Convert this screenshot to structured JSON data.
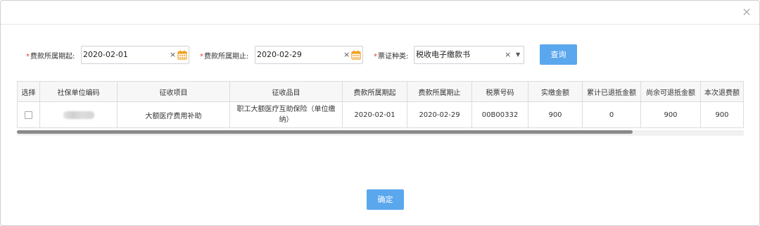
{
  "dialog": {
    "close_icon": "×"
  },
  "filters": {
    "period_start": {
      "label": "费款所属期起:",
      "value": "2020-02-01"
    },
    "period_end": {
      "label": "费款所属期止:",
      "value": "2020-02-29"
    },
    "voucher_type": {
      "label": "票证种类:",
      "value": "税收电子缴款书"
    },
    "required_mark": "*",
    "clear_glyph": "×",
    "caret_glyph": "▼",
    "query_label": "查询"
  },
  "table": {
    "headers": [
      "选择",
      "社保单位编码",
      "征收项目",
      "征收品目",
      "费款所属期起",
      "费款所属期止",
      "税票号码",
      "实缴金额",
      "累计已退抵金额",
      "尚余可退抵金额",
      "本次退费额"
    ],
    "rows": [
      {
        "unit_code": "",
        "item": "大额医疗费用补助",
        "sub_item": "职工大额医疗互助保险（单位缴纳）",
        "period_start": "2020-02-01",
        "period_end": "2020-02-29",
        "ticket_no": "00B00332",
        "paid": "900",
        "refunded": "0",
        "remaining": "900",
        "this_refund": "900"
      }
    ]
  },
  "footer": {
    "confirm_label": "确定"
  }
}
